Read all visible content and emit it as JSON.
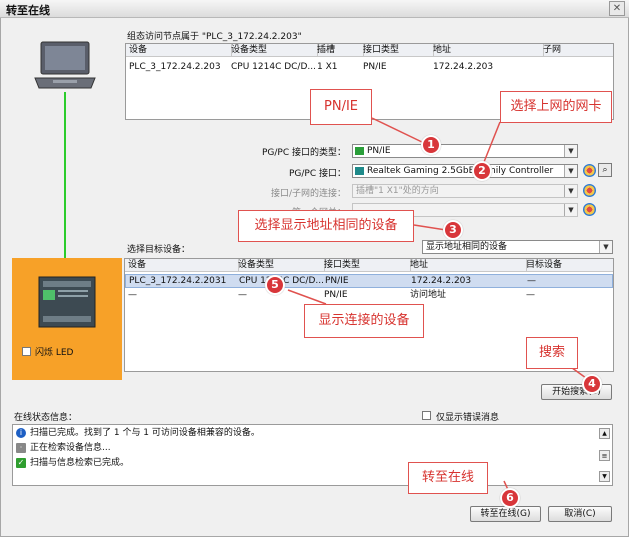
{
  "window": {
    "title": "转至在线",
    "close_icon": "close-icon"
  },
  "node_group": {
    "caption": "组态访问节点属于 \"PLC_3_172.24.2.203\"",
    "columns": [
      "设备",
      "设备类型",
      "插槽",
      "接口类型",
      "地址",
      "子网"
    ],
    "row": [
      "PLC_3_172.24.2.203",
      "CPU 1214C DC/D...",
      "1 X1",
      "PN/IE",
      "172.24.2.203",
      ""
    ]
  },
  "interface": {
    "type_label": "PG/PC 接口的类型：",
    "type_value": "PN/IE",
    "iface_label": "PG/PC 接口：",
    "iface_value": "Realtek Gaming 2.5GbE Family Controller",
    "conn_label": "接口/子网的连接：",
    "conn_value": "插槽\"1 X1\"处的方向",
    "gateway_label": "第一个网关："
  },
  "target": {
    "label": "选择目标设备：",
    "filter_value": "显示地址相同的设备",
    "columns": [
      "设备",
      "设备类型",
      "接口类型",
      "地址",
      "目标设备"
    ],
    "rows": [
      [
        "PLC_3_172.24.2.2031",
        "CPU 1214C DC/D...",
        "PN/IE",
        "172.24.2.203",
        "—"
      ],
      [
        "—",
        "—",
        "PN/IE",
        "访问地址",
        "—"
      ]
    ]
  },
  "flash_led_label": "闪烁 LED",
  "start_search_label": "开始搜索(S)",
  "status": {
    "label": "在线状态信息：",
    "show_errors_label": "仅显示错误消息",
    "messages": [
      "扫描已完成。找到了 1 个与 1 可访问设备相兼容的设备。",
      "正在检索设备信息...",
      "扫描与信息检索已完成。"
    ]
  },
  "buttons": {
    "go_online": "转至在线(G)",
    "cancel": "取消(C)"
  },
  "annotations": {
    "pnie": "PN/IE",
    "select_nic": "选择上网的网卡",
    "select_same_addr": "选择显示地址相同的设备",
    "show_connected": "显示连接的设备",
    "search": "搜索",
    "go_online": "转至在线",
    "badges": [
      "1",
      "2",
      "3",
      "4",
      "5",
      "6"
    ]
  },
  "colors": {
    "annotation_red": "#d7332f",
    "badge_red": "#d8363a",
    "device_panel_orange": "#f7a128",
    "link_green": "#2bcc2b"
  }
}
